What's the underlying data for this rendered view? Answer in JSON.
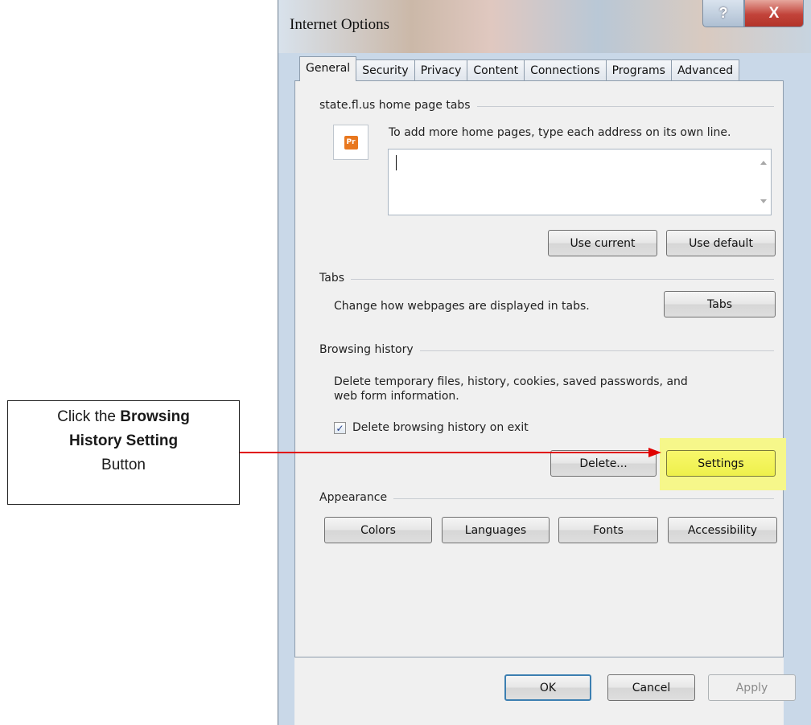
{
  "callout": {
    "line1_prefix": "Click the ",
    "line1_bold": "Browsing",
    "line2_bold": "History Setting",
    "line3": "Button"
  },
  "window": {
    "title": "Internet Options",
    "help_label": "?",
    "close_label": "X"
  },
  "tabs": [
    {
      "label": "General",
      "active": true
    },
    {
      "label": "Security"
    },
    {
      "label": "Privacy"
    },
    {
      "label": "Content"
    },
    {
      "label": "Connections"
    },
    {
      "label": "Programs"
    },
    {
      "label": "Advanced"
    }
  ],
  "home": {
    "section_label": "state.fl.us home page tabs",
    "instruction": "To add more home pages, type each address on its own line.",
    "icon_text": "Pr",
    "textarea_value": "",
    "use_current_label": "Use current",
    "use_default_label": "Use default"
  },
  "tabs_section": {
    "section_label": "Tabs",
    "description": "Change how webpages are displayed in tabs.",
    "button_label": "Tabs"
  },
  "history": {
    "section_label": "Browsing history",
    "description_line1": "Delete temporary files, history, cookies, saved passwords, and",
    "description_line2": "web form information.",
    "checkbox_label": "Delete browsing history on exit",
    "checkbox_checked": true,
    "delete_label": "Delete...",
    "settings_label": "Settings"
  },
  "appearance": {
    "section_label": "Appearance",
    "colors_label": "Colors",
    "languages_label": "Languages",
    "fonts_label": "Fonts",
    "accessibility_label": "Accessibility"
  },
  "footer": {
    "ok_label": "OK",
    "cancel_label": "Cancel",
    "apply_label": "Apply"
  },
  "colors": {
    "highlight": "#f6f78a",
    "arrow": "#e00000",
    "close_button": "#c2433a"
  }
}
